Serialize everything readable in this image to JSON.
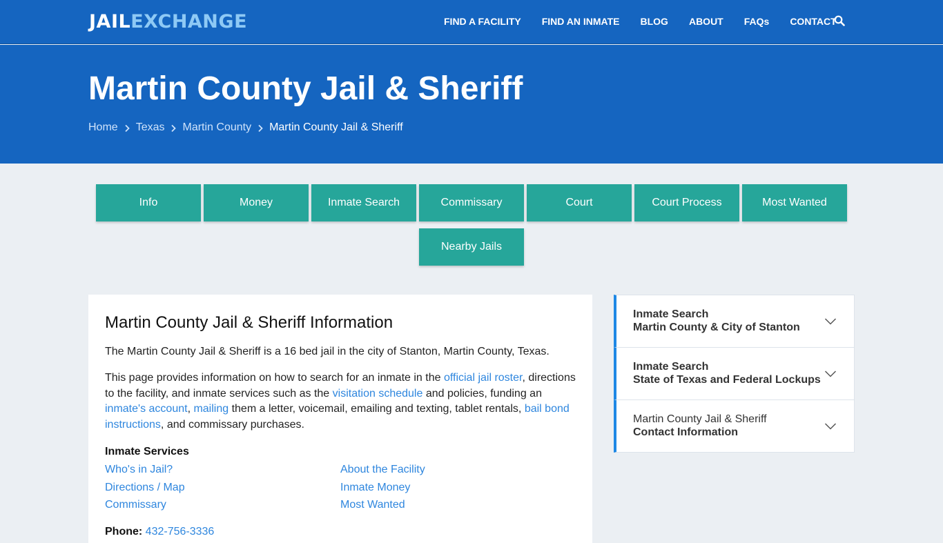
{
  "header": {
    "logo_part1": "JAIL",
    "logo_part2": "EXCHANGE",
    "nav": [
      "FIND A FACILITY",
      "FIND AN INMATE",
      "BLOG",
      "ABOUT",
      "FAQs",
      "CONTACT"
    ],
    "search_icon": "search-icon"
  },
  "hero": {
    "title": "Martin County Jail & Sheriff",
    "breadcrumbs": [
      "Home",
      "Texas",
      "Martin County",
      "Martin County Jail & Sheriff"
    ]
  },
  "tabs": [
    "Info",
    "Money",
    "Inmate Search",
    "Commissary",
    "Court",
    "Court Process",
    "Most Wanted",
    "Nearby Jails"
  ],
  "main": {
    "heading": "Martin County Jail & Sheriff Information",
    "intro": "The Martin County Jail & Sheriff is a 16 bed jail in the city of Stanton, Martin County, Texas.",
    "p2": {
      "t1": "This page provides information on how to search for an inmate in the ",
      "l1": "official jail roster",
      "t2": ", directions to the facility, and inmate services such as the ",
      "l2": "visitation schedule",
      "t3": " and policies, funding an ",
      "l3": "inmate's account",
      "t4": ", ",
      "l4": "mailing",
      "t5": " them a letter, voicemail, emailing and texting, tablet rentals, ",
      "l5": "bail bond instructions",
      "t6": ", and commissary purchases."
    },
    "services_title": "Inmate Services",
    "services": [
      "Who's in Jail?",
      "About the Facility",
      "Directions / Map",
      "Inmate Money",
      "Commissary",
      "Most Wanted"
    ],
    "phone_label": "Phone:",
    "phone_value": "432-756-3336"
  },
  "sidebar": [
    {
      "line1": "Inmate Search",
      "line2": "Martin County & City of Stanton"
    },
    {
      "line1": "Inmate Search",
      "line2": "State of Texas and Federal Lockups"
    },
    {
      "line1": "Martin County Jail & Sheriff",
      "line2": "Contact Information"
    }
  ],
  "colors": {
    "brand_blue": "#1565c0",
    "tab_teal": "#26a69a",
    "link_blue": "#2e86de",
    "accent_border": "#1e88e5"
  }
}
